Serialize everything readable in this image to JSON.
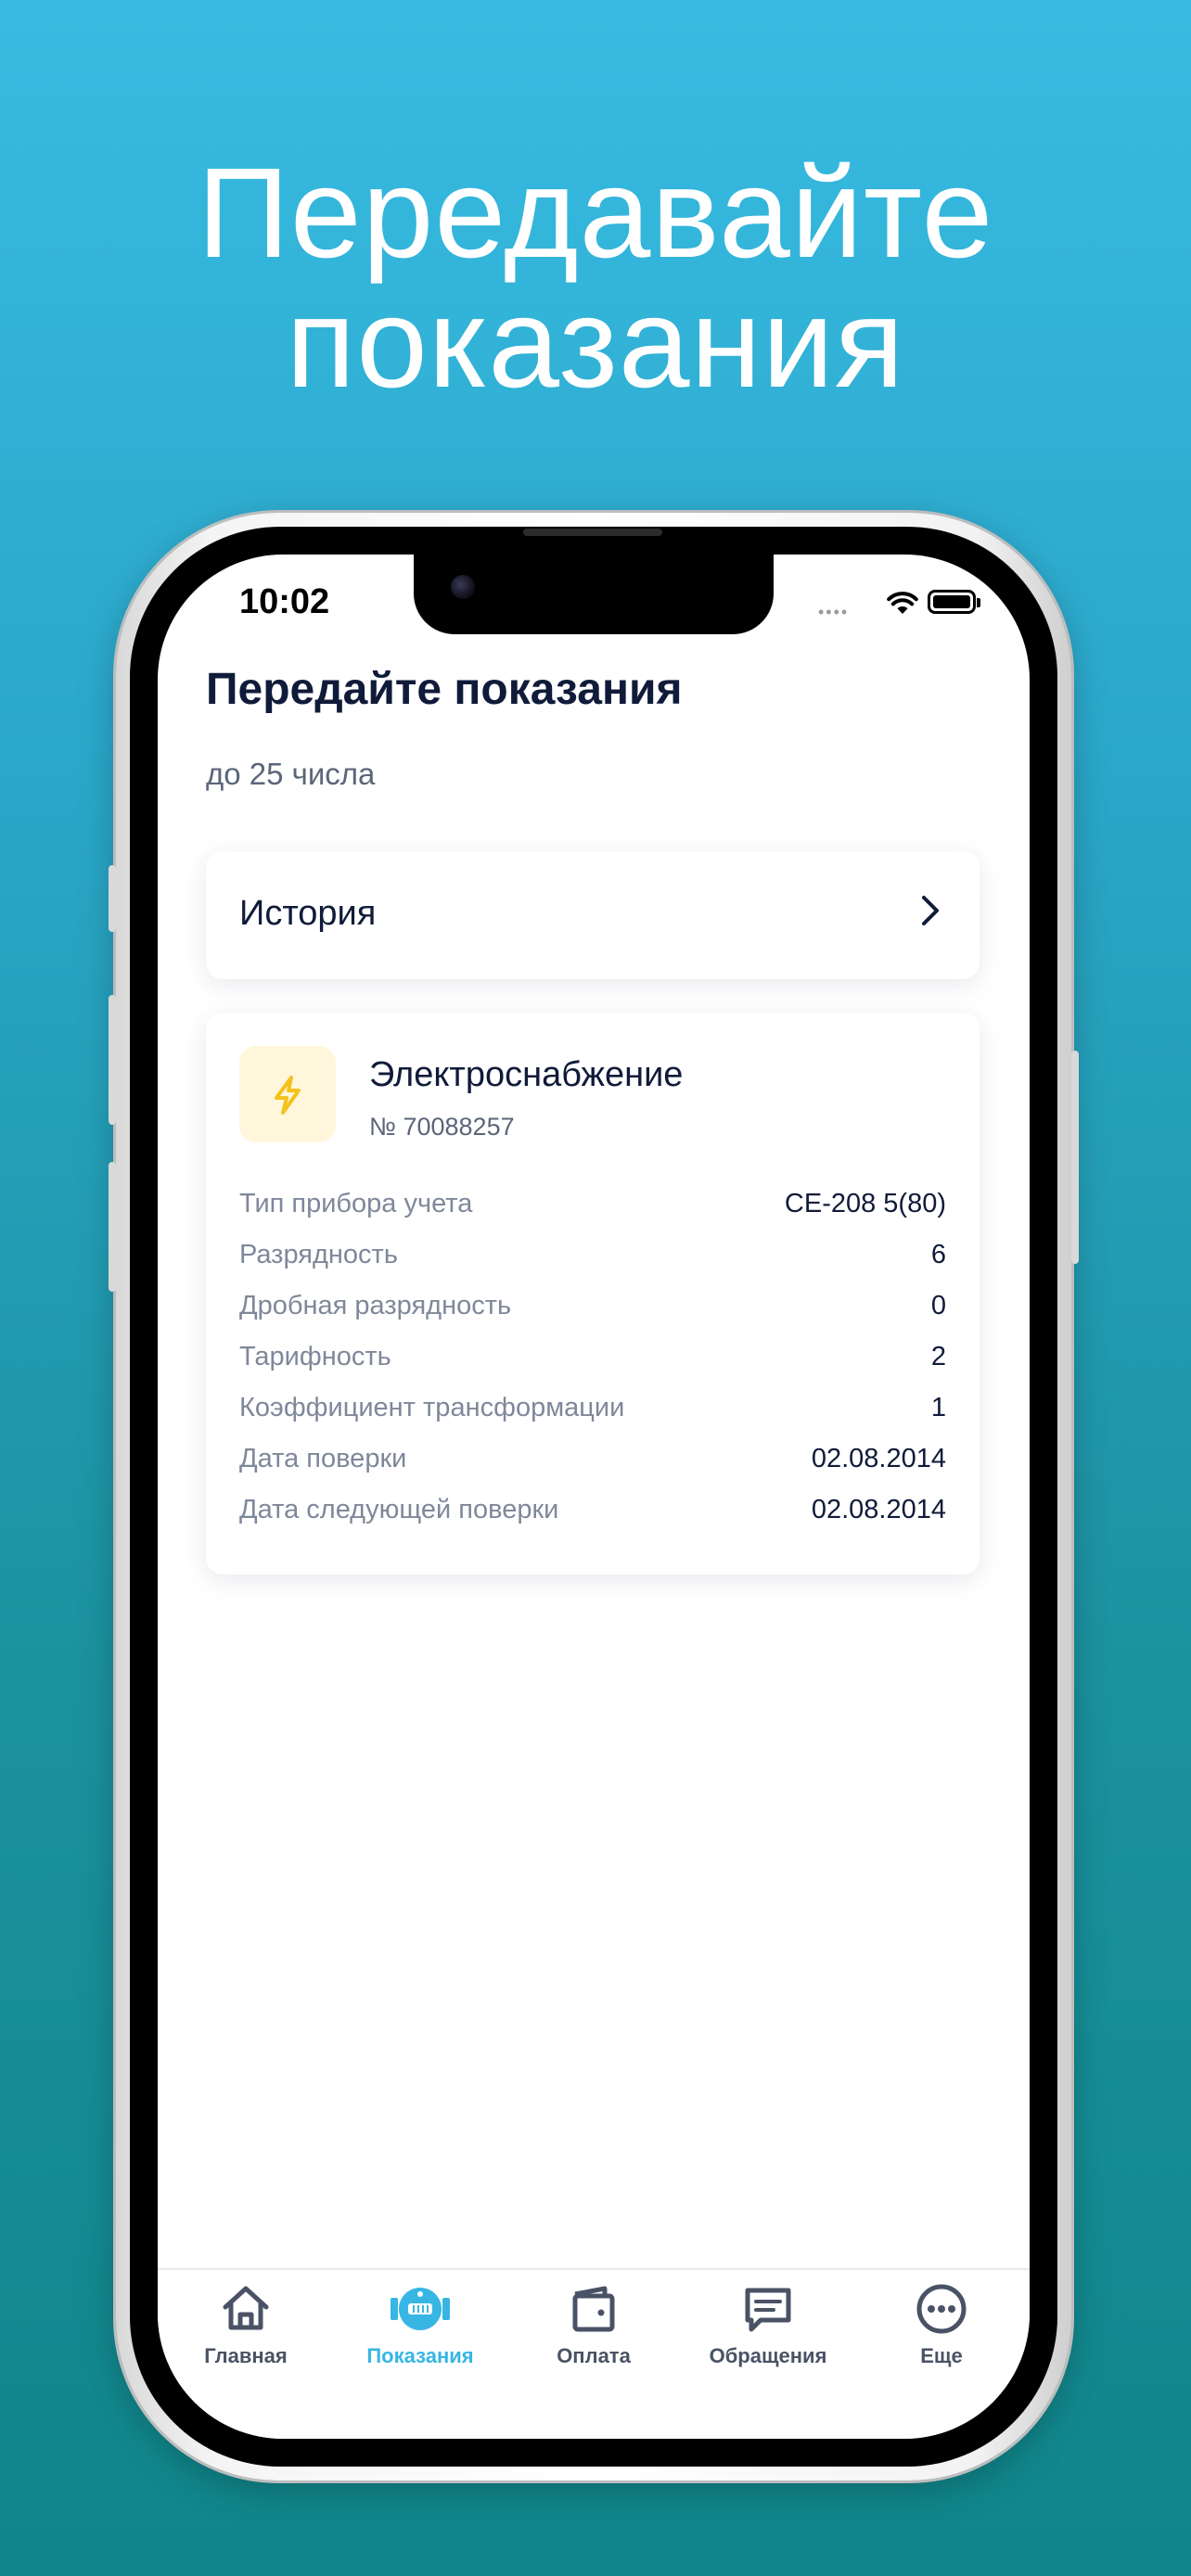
{
  "promo": {
    "headline_line1": "Передавайте",
    "headline_line2": "показания"
  },
  "status_bar": {
    "time": "10:02"
  },
  "page": {
    "title": "Передайте показания",
    "subtitle": "до 25 числа"
  },
  "history": {
    "label": "История"
  },
  "meter": {
    "name": "Электроснабжение",
    "number": "№ 70088257",
    "icon": "lightning-icon",
    "details": [
      {
        "label": "Тип прибора учета",
        "value": "CE-208 5(80)"
      },
      {
        "label": "Разрядность",
        "value": "6"
      },
      {
        "label": "Дробная разрядность",
        "value": "0"
      },
      {
        "label": "Тарифность",
        "value": "2"
      },
      {
        "label": "Коэффициент трансформации",
        "value": "1"
      },
      {
        "label": "Дата поверки",
        "value": "02.08.2014"
      },
      {
        "label": "Дата следующей поверки",
        "value": "02.08.2014"
      }
    ]
  },
  "tabbar": {
    "tabs": [
      {
        "label": "Главная",
        "icon": "home-icon",
        "active": false
      },
      {
        "label": "Показания",
        "icon": "meter-icon",
        "active": true
      },
      {
        "label": "Оплата",
        "icon": "wallet-icon",
        "active": false
      },
      {
        "label": "Обращения",
        "icon": "chat-icon",
        "active": false
      },
      {
        "label": "Еще",
        "icon": "more-icon",
        "active": false
      }
    ]
  },
  "colors": {
    "accent": "#37b6e3",
    "text_primary": "#101b3a",
    "text_secondary": "#7f889a",
    "icon_bg": "#fff6dc",
    "icon_fg": "#f5c21b"
  }
}
